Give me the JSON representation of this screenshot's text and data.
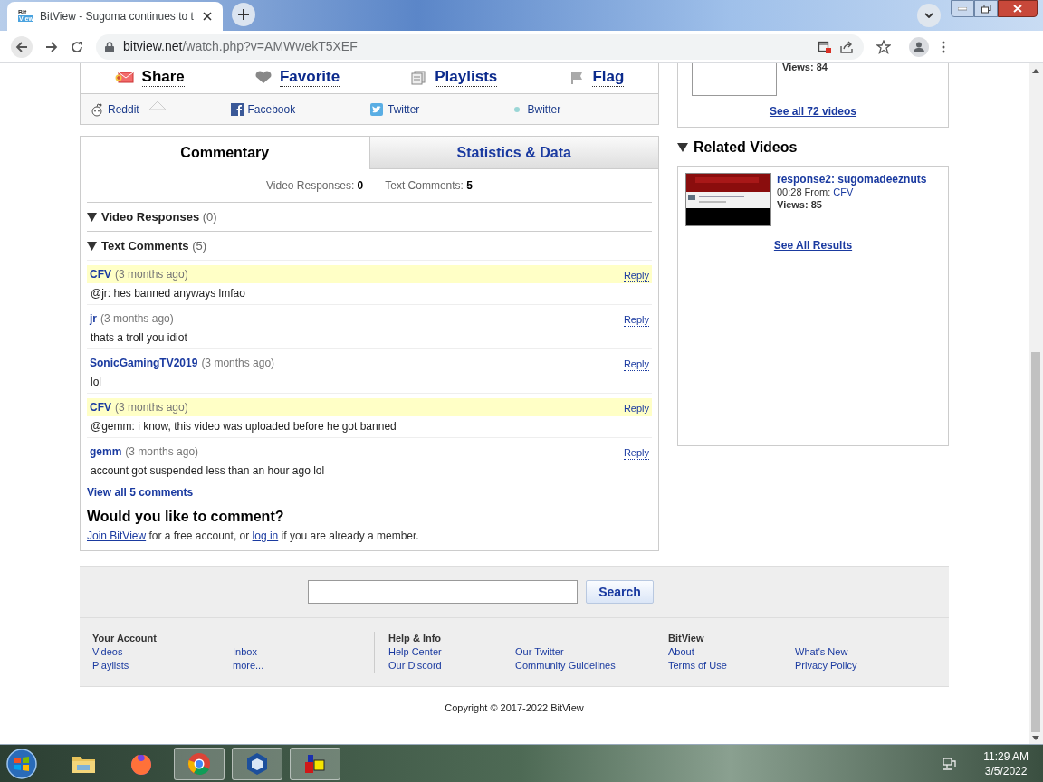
{
  "browser": {
    "favicon": [
      "Bit",
      "View"
    ],
    "tab_title": "BitView - Sugoma continues to t",
    "url_host": "bitview.net",
    "url_path": "/watch.php?v=AMWwekT5XEF"
  },
  "share_actions": [
    {
      "label": "Share",
      "kind": "share",
      "selected": true
    },
    {
      "label": "Favorite",
      "kind": "favorite",
      "selected": false
    },
    {
      "label": "Playlists",
      "kind": "playlists",
      "selected": false
    },
    {
      "label": "Flag",
      "kind": "flag",
      "selected": false
    }
  ],
  "social_links": [
    {
      "label": "Reddit",
      "kind": "reddit"
    },
    {
      "label": "Facebook",
      "kind": "facebook"
    },
    {
      "label": "Twitter",
      "kind": "twitter"
    },
    {
      "label": "Bwitter",
      "kind": "bwitter"
    }
  ],
  "comment_tabs": [
    {
      "label": "Commentary",
      "selected": true
    },
    {
      "label": "Statistics & Data",
      "selected": false
    }
  ],
  "counts": [
    {
      "label": "Video Responses:",
      "value": "0"
    },
    {
      "label": "Text Comments:",
      "value": "5"
    }
  ],
  "sections": [
    {
      "title": "Video Responses",
      "count": "(0)",
      "expanded": true
    },
    {
      "title": "Text Comments",
      "count": "(5)",
      "expanded": true
    }
  ],
  "comments": [
    {
      "user": "CFV",
      "time": "(3 months ago)",
      "body": "@jr: hes banned anyways lmfao",
      "highlighted": true,
      "reply": "Reply"
    },
    {
      "user": "jr",
      "time": "(3 months ago)",
      "body": "thats a troll you idiot",
      "highlighted": false,
      "reply": "Reply"
    },
    {
      "user": "SonicGamingTV2019",
      "time": "(3 months ago)",
      "body": "lol",
      "highlighted": false,
      "reply": "Reply"
    },
    {
      "user": "CFV",
      "time": "(3 months ago)",
      "body": "@gemm: i know, this video was uploaded before he got banned",
      "highlighted": true,
      "reply": "Reply"
    },
    {
      "user": "gemm",
      "time": "(3 months ago)",
      "body": "account got suspended less than an hour ago lol",
      "highlighted": false,
      "reply": "Reply"
    }
  ],
  "view_all": "View all 5 comments",
  "comment_prompt": {
    "heading": "Would you like to comment?",
    "parts": [
      {
        "text": "Join BitView",
        "link": true
      },
      {
        "text": " for a free account, or ",
        "link": false
      },
      {
        "text": "log in",
        "link": true
      },
      {
        "text": " if you are already a member.",
        "link": false
      }
    ]
  },
  "user_videos": {
    "views": "Views: 84",
    "see_all": "See all 72 videos"
  },
  "related": {
    "title": "Related Videos",
    "expanded": true,
    "videos": [
      {
        "title": "response2: sugomadeeznuts",
        "duration": "00:28",
        "from_label": "From:",
        "from": "CFV",
        "views": "Views: 85"
      }
    ],
    "see_all": "See All Results"
  },
  "footer": {
    "search_button": "Search",
    "columns": [
      {
        "title": "Your Account",
        "links": [
          "Videos",
          "Playlists",
          "Inbox",
          "more..."
        ]
      },
      {
        "title": "Help & Info",
        "links": [
          "Help Center",
          "Our Discord",
          "Our Twitter",
          "Community Guidelines"
        ]
      },
      {
        "title": "BitView",
        "links": [
          "About",
          "Terms of Use",
          "What's New",
          "Privacy Policy"
        ]
      }
    ],
    "copyright": "Copyright © 2017-2022 BitView"
  },
  "taskbar": {
    "apps": [
      {
        "kind": "explorer",
        "active": false
      },
      {
        "kind": "firefox",
        "active": false
      },
      {
        "kind": "chrome",
        "active": true
      },
      {
        "kind": "virtualbox",
        "active": true
      },
      {
        "kind": "app",
        "active": true
      }
    ],
    "time": "11:29 AM",
    "date": "3/5/2022"
  }
}
